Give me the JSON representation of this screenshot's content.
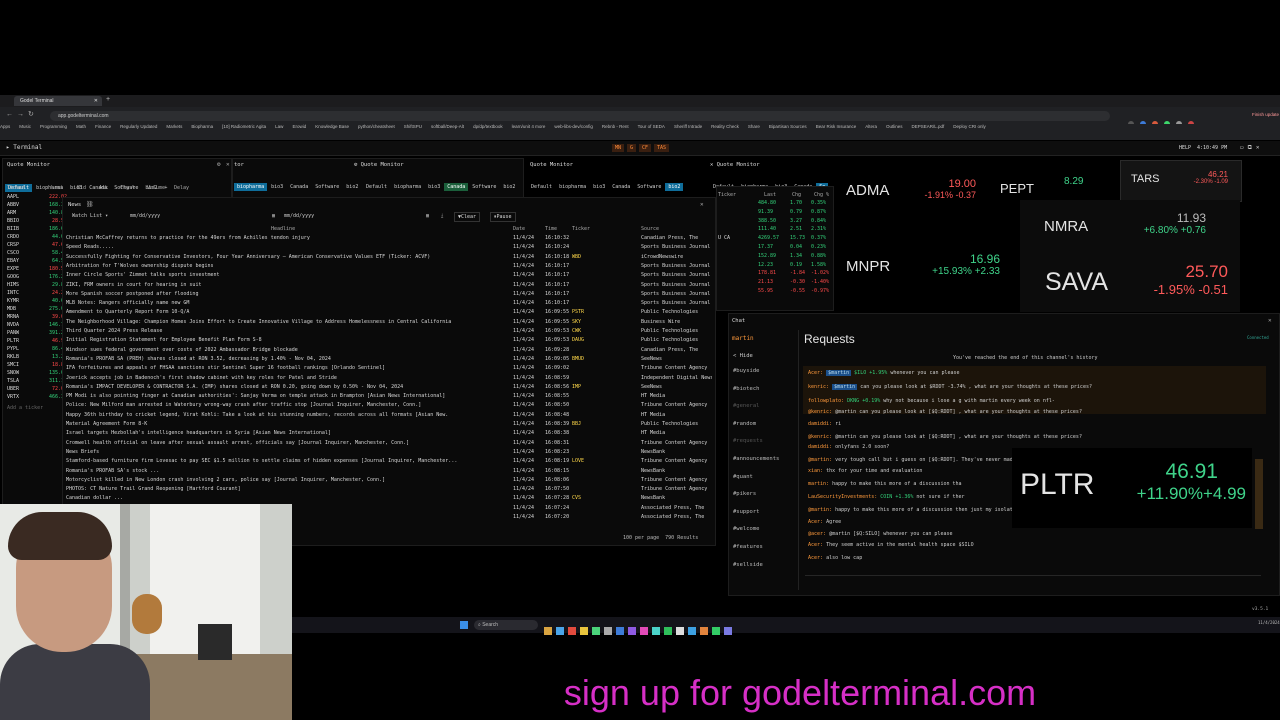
{
  "browser": {
    "tab_title": "Godel Terminal",
    "url": "app.godelterminal.com",
    "bookmarks": [
      "Apps",
      "Music",
      "Programming",
      "Math",
      "Finance",
      "Regularly Updated",
      "Markets",
      "Biopharma",
      "[10] Radiometric Agita",
      "Law",
      "Erowid",
      "Knowledge Base",
      "python/cheatsheet",
      "ShiftSPU",
      "softball/Deep-Alt",
      "dp/dp/textbook",
      "learn/unit 4 more",
      "web-libs-dev/config",
      "Rebnb - Rent",
      "Tour of SEDA",
      "Sheriff Intrade",
      "Reality Check",
      "Share",
      "Bipartisan Sources",
      "Bear Risk Insurance",
      "Altera",
      "Outlines",
      "DEPSEAR/L.pdf",
      "Deploy CRI only"
    ]
  },
  "terminal": {
    "title": "Terminal",
    "fn_keys": [
      "MN",
      "G",
      "CF",
      "TAS"
    ],
    "help": "HELP",
    "clock": "4:10:49 PM",
    "upgrade": "Finish update"
  },
  "quote_monitors": [
    {
      "title": "Quote Monitor",
      "tabs": [
        "Default",
        "biopharma",
        "bio3",
        "Canada",
        "Software",
        "bio2"
      ]
    },
    {
      "title": "Quote Monitor",
      "tabs": [
        "biopharma",
        "bio3",
        "Canada",
        "Software",
        "bio2"
      ]
    },
    {
      "title": "Quote Monitor",
      "tabs": [
        "Default",
        "biopharma",
        "bio3",
        "Canada",
        "Software",
        "bio2"
      ]
    },
    {
      "title": "Quote Monitor",
      "tabs": [
        "Default",
        "biopharma",
        "bio3",
        "Canada",
        "Software",
        "bio2"
      ]
    }
  ],
  "qm1": {
    "headers": [
      "Ticker",
      "Last",
      "Bid",
      "Ask",
      "Chg %",
      "Volume",
      "Delay"
    ],
    "rows": [
      {
        "t": "AAPL",
        "v": "222.02"
      },
      {
        "t": "ABBV",
        "v": "168.31"
      },
      {
        "t": "ARM",
        "v": "140.88"
      },
      {
        "t": "BBIO",
        "v": "28.54"
      },
      {
        "t": "BIIB",
        "v": "186.65"
      },
      {
        "t": "CRDO",
        "v": "44.02"
      },
      {
        "t": "CRSP",
        "v": "47.67"
      },
      {
        "t": "CSCO",
        "v": "58.48"
      },
      {
        "t": "EBAY",
        "v": "64.52"
      },
      {
        "t": "EXPE",
        "v": "180.56"
      },
      {
        "t": "GOOG",
        "v": "176.22"
      },
      {
        "t": "HIMS",
        "v": "29.89"
      },
      {
        "t": "INTC",
        "v": "24.26"
      },
      {
        "t": "KYMR",
        "v": "40.62"
      },
      {
        "t": "MDB",
        "v": "275.00"
      },
      {
        "t": "MRNA",
        "v": "39.00"
      },
      {
        "t": "NVDA",
        "v": "146.76"
      },
      {
        "t": "PANW",
        "v": "391.21"
      },
      {
        "t": "PLTR",
        "v": "46.91"
      },
      {
        "t": "PYPL",
        "v": "86.48"
      },
      {
        "t": "RKLB",
        "v": "13.24"
      },
      {
        "t": "SMCI",
        "v": "18.86"
      },
      {
        "t": "SNOW",
        "v": "135.00"
      },
      {
        "t": "TSLA",
        "v": "311.18"
      },
      {
        "t": "UBER",
        "v": "72.00"
      },
      {
        "t": "VRTX",
        "v": "466.38"
      }
    ],
    "add_placeholder": "Add a ticker"
  },
  "news": {
    "title": "News",
    "watchlist_label": "Watch List",
    "date_from": "mm/dd/yyyy",
    "date_to": "mm/dd/yyyy",
    "clear_label": "Clear",
    "pause_label": "Pause",
    "headers": [
      "Headline",
      "Date",
      "Time",
      "Ticker",
      "Source"
    ],
    "rows": [
      [
        "Christian McCaffrey returns to practice for the 49ers from Achilles tendon injury",
        "11/4/24",
        "16:10:32",
        "",
        "Canadian Press, The"
      ],
      [
        "Speed Reads.....",
        "11/4/24",
        "16:10:24",
        "",
        "Sports Business Journal"
      ],
      [
        "Successfully Fighting for Conservative Investors, Four Year Anniversary — American Conservative Values ETF (Ticker: ACVF)",
        "11/4/24",
        "16:10:18",
        "WBD",
        "iCrowdNewswire"
      ],
      [
        "Arbitration for T'Wolves ownership dispute begins",
        "11/4/24",
        "16:10:17",
        "",
        "Sports Business Journal"
      ],
      [
        "Inner Circle Sports' Zimmet talks sports investment",
        "11/4/24",
        "16:10:17",
        "",
        "Sports Business Journal"
      ],
      [
        "ZIKI, FRM owners in court for hearing in suit",
        "11/4/24",
        "16:10:17",
        "",
        "Sports Business Journal"
      ],
      [
        "More Spanish soccer postponed after flooding",
        "11/4/24",
        "16:10:17",
        "",
        "Sports Business Journal"
      ],
      [
        "MLB Notes: Rangers officially name new GM",
        "11/4/24",
        "16:10:17",
        "",
        "Sports Business Journal"
      ],
      [
        "Amendment to Quarterly Report Form 10-Q/A",
        "11/4/24",
        "16:09:55",
        "PSTR",
        "Public Technologies"
      ],
      [
        "The Neighborhood Village: Champion Homes Joins Effort to Create Innovative Village to Address Homelessness in Central California",
        "11/4/24",
        "16:09:55",
        "SKY",
        "Business Wire"
      ],
      [
        "Third Quarter 2024 Press Release",
        "11/4/24",
        "16:09:53",
        "CWK",
        "Public Technologies"
      ],
      [
        "Initial Registration Statement for Employee Benefit Plan Form S-8",
        "11/4/24",
        "16:09:53",
        "DAUG",
        "Public Technologies"
      ],
      [
        "Windsor sues federal government over costs of 2022 Ambassador Bridge blockade",
        "11/4/24",
        "16:09:28",
        "",
        "Canadian Press, The"
      ],
      [
        "Romania's PROFAB SA (PREH) shares closed at RON 3.52, decreasing by 1.40% - Nov 04, 2024",
        "11/4/24",
        "16:09:05",
        "BMUD",
        "SeeNews"
      ],
      [
        "IFA forfeitures and appeals of FHSAA sanctions stir Sentinel Super 16 football rankings [Orlando Sentinel]",
        "11/4/24",
        "16:09:02",
        "",
        "Tribune Content Agency"
      ],
      [
        "Joerick accepts job in Badenoch's first shadow cabinet with key roles for Patel and Stride",
        "11/4/24",
        "16:08:59",
        "",
        "Independent Digital News and Med."
      ],
      [
        "Romania's IMPACT DEVELOPER & CONTRACTOR S.A. (IMP) shares closed at RON 0.20, going down by 0.50% - Nov 04, 2024",
        "11/4/24",
        "16:08:56",
        "IMP",
        "SeeNews"
      ],
      [
        "PM Modi is also pointing finger at Canadian authorities': Sanjay Verma on temple attack in Brampton [Asian News International]",
        "11/4/24",
        "16:08:55",
        "",
        "HT Media"
      ],
      [
        "Police: New Milford man arrested in Waterbury wrong-way crash after traffic stop [Journal Inquirer, Manchester, Conn.]",
        "11/4/24",
        "16:08:50",
        "",
        "Tribune Content Agency"
      ],
      [
        "Happy 36th birthday to cricket legend, Virat Kohli: Take a look at his stunning numbers, records across all formats [Asian New.",
        "11/4/24",
        "16:08:48",
        "",
        "HT Media"
      ],
      [
        "Material Agreement Form 8-K",
        "11/4/24",
        "16:08:39",
        "BBJ",
        "Public Technologies"
      ],
      [
        "Israel targets Hezbollah's intelligence headquarters in Syria [Asian News International]",
        "11/4/24",
        "16:08:38",
        "",
        "HT Media"
      ],
      [
        "Cromwell health official on leave after sexual assault arrest, officials say [Journal Inquirer, Manchester, Conn.]",
        "11/4/24",
        "16:08:31",
        "",
        "Tribune Content Agency"
      ],
      [
        "News Briefs",
        "11/4/24",
        "16:08:23",
        "",
        "NewsBank"
      ],
      [
        "Stamford-based furniture firm Lovesac to pay SEC $1.5 million to settle claims of hidden expenses [Journal Inquirer, Manchester...",
        "11/4/24",
        "16:08:19",
        "LOVE",
        "Tribune Content Agency"
      ],
      [
        "Romania's PROFAB SA's stock ...",
        "11/4/24",
        "16:08:15",
        "",
        "NewsBank"
      ],
      [
        "Motorcyclist killed in New London crash involving 2 cars, police say [Journal Inquirer, Manchester, Conn.]",
        "11/4/24",
        "16:08:06",
        "",
        "Tribune Content Agency"
      ],
      [
        "PHOTOS: CT Nature Trail Grand Reopening [Hartford Courant]",
        "11/4/24",
        "16:07:50",
        "",
        "Tribune Content Agency"
      ],
      [
        "Canadian dollar ...",
        "11/4/24",
        "16:07:28",
        "CVS",
        "NewsBank"
      ],
      [
        "...",
        "11/4/24",
        "16:07:24",
        "",
        "Associated Press, The"
      ],
      [
        "...aid in Gaza",
        "11/4/24",
        "16:07:20",
        "",
        "Associated Press, The"
      ]
    ],
    "footer_per_page": "100 per page",
    "footer_results": "790 Results"
  },
  "qm4": {
    "headers": [
      "Ticker",
      "Last",
      "Chg",
      "Chg %"
    ],
    "rows": [
      {
        "t": "",
        "last": "484.80",
        "chg": "1.70",
        "pct": "0.35%"
      },
      {
        "t": "",
        "last": "91.39",
        "chg": "0.79",
        "pct": "0.87%"
      },
      {
        "t": "",
        "last": "388.50",
        "chg": "3.27",
        "pct": "0.84%"
      },
      {
        "t": "",
        "last": "111.40",
        "chg": "2.51",
        "pct": "2.31%"
      },
      {
        "t": "U CA",
        "last": "4269.57",
        "chg": "15.73",
        "pct": "0.37%"
      },
      {
        "t": "",
        "last": "17.37",
        "chg": "0.04",
        "pct": "0.23%"
      },
      {
        "t": "",
        "last": "152.89",
        "chg": "1.34",
        "pct": "0.88%"
      },
      {
        "t": "",
        "last": "12.23",
        "chg": "0.19",
        "pct": "1.58%"
      },
      {
        "t": "",
        "last": "178.81",
        "chg": "-1.84",
        "pct": "-1.02%"
      },
      {
        "t": "",
        "last": "21.13",
        "chg": "-0.30",
        "pct": "-1.40%"
      },
      {
        "t": "",
        "last": "55.95",
        "chg": "-0.55",
        "pct": "-0.97%"
      }
    ]
  },
  "tiles": [
    {
      "sym": "ADMA",
      "price": "19.00",
      "chg": "-1.91%  -0.37",
      "dir": "down"
    },
    {
      "sym": "PEPT",
      "price": "8.29",
      "chg": "",
      "dir": "up"
    },
    {
      "sym": "TARS",
      "price": "46.21",
      "chg": "-2.30% -1.09",
      "dir": "down"
    },
    {
      "sym": "NMRA",
      "price": "11.93",
      "chg": "+6.80% +0.76",
      "dir": "up"
    },
    {
      "sym": "MNPR",
      "price": "16.96",
      "chg": "+15.93% +2.33",
      "dir": "up"
    },
    {
      "sym": "SAVA",
      "price": "25.70",
      "chg": "-1.95% -0.51",
      "dir": "down"
    },
    {
      "sym": "PLTR",
      "price": "46.91",
      "chg": "+11.90%+4.99",
      "dir": "up"
    }
  ],
  "chat": {
    "title": "Chat",
    "user": "martin",
    "hide_label": "< Hide",
    "channels": [
      "#buyside",
      "#biotech",
      "#general",
      "#random",
      "#requests",
      "#announcements",
      "#quant",
      "#pikers",
      "#support",
      "#welcome",
      "#features",
      "#sellside"
    ],
    "channel_title": "Requests",
    "connected": "Connected",
    "history_note": "You've reached the end of this channel's history",
    "messages": [
      {
        "user": "Acer:",
        "tag": "$martin",
        "tagval": "$ILO +1.95%",
        "text": "whenever you can please"
      },
      {
        "user": "kenric:",
        "tag": "$martin",
        "tagval": "",
        "text": "can you please look at $RDDT -3.74% , what are your thoughts at these prices?"
      },
      {
        "user": "followplato:",
        "tag": "",
        "tagval": "DKNG +0.19%",
        "text": "why not because i lose a g with martin every week on nfl-"
      },
      {
        "user": "@kenric:",
        "tag": "",
        "tagval": "",
        "text": "@martin can you please look at [$Q:RDDT] , what are your thoughts at these prices?"
      },
      {
        "user": "damiddi:",
        "tag": "",
        "tagval": "",
        "text": "ri"
      },
      {
        "user": "@kenric:",
        "tag": "",
        "tagval": "",
        "text": "@martin can you please look at [$Q:RDDT] , what are your thoughts at these prices?"
      },
      {
        "user": "damiddi:",
        "tag": "",
        "tagval": "",
        "text": "onlyfans 2.0 soon?"
      },
      {
        "user": "@martin:",
        "tag": "",
        "tagval": "",
        "text": "very tough call but i guess on [$Q:RDDT]. They've never made ..."
      },
      {
        "user": "xian:",
        "tag": "",
        "tagval": "",
        "text": "thx for your time and evaluation"
      },
      {
        "user": "martin:",
        "tag": "",
        "tagval": "",
        "text": "happy to make this more of a discussion tha"
      },
      {
        "user": "LauSecurityInvestments:",
        "tag": "",
        "tagval": "COIN +1.36%",
        "text": "not sure if ther"
      },
      {
        "user": "@martin:",
        "tag": "",
        "tagval": "",
        "text": "happy to make this more of a discussion then just my isolate"
      },
      {
        "user": "Acer:",
        "tag": "",
        "tagval": "",
        "text": "Agree"
      },
      {
        "user": "@acer:",
        "tag": "",
        "tagval": "",
        "text": "@martin [$Q:SILO] whenever you can please"
      },
      {
        "user": "Acer:",
        "tag": "",
        "tagval": "",
        "text": "They seem active in the mental health space $SILO"
      },
      {
        "user": "Acer:",
        "tag": "",
        "tagval": "",
        "text": "also low cap"
      }
    ],
    "version": "v3.5.1"
  },
  "taskbar": {
    "search_label": "Search",
    "date": "11/4/2024"
  },
  "banner": "sign up for godelterminal.com",
  "colors": {
    "accent": "#0f6d9a",
    "up": "#3fd38a",
    "down": "#ff5a5a",
    "banner": "#d62fc6",
    "orange": "#ff8c3a"
  }
}
